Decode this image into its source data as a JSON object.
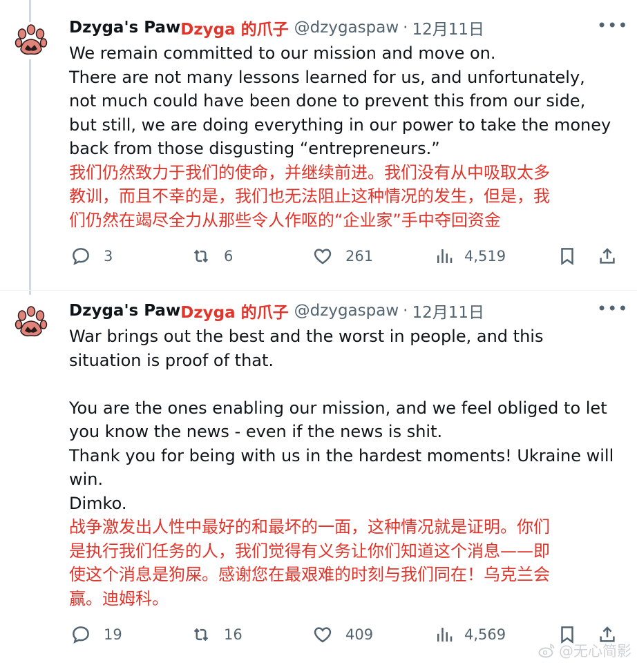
{
  "tweets": [
    {
      "author_name": "Dzyga's Paw",
      "author_name_cn": "Dzyga 的爪子",
      "handle": "@dzygaspaw",
      "separator": "·",
      "date": "12月11日",
      "more_label": "•••",
      "text_en": [
        "We remain committed to our mission and move on.",
        "There are not many lessons learned for us, and unfortunately,",
        "not much could have been done to prevent this from our side,",
        "but still, we are doing everything in our power to take the money",
        "back from those disgusting “entrepreneurs.”"
      ],
      "text_cn": [
        "我们仍然致力于我们的使命，并继续前进。我们没有从中吸取太多",
        "教训，而且不幸的是，我们也无法阻止这种情况的发生，但是，我",
        "们仍然在竭尽全力从那些令人作呕的“企业家”手中夺回资金"
      ],
      "replies": "3",
      "retweets": "6",
      "likes": "261",
      "views": "4,519"
    },
    {
      "author_name": "Dzyga's Paw",
      "author_name_cn": "Dzyga 的爪子",
      "handle": "@dzygaspaw",
      "separator": "·",
      "date": "12月11日",
      "more_label": "•••",
      "text_en": [
        "War brings out the best and the worst in people, and this",
        "situation is proof of that.",
        "",
        "You are the ones enabling our mission, and we feel obliged to let",
        "you know the news - even if the news is shit.",
        "Thank you for being with us in the hardest moments! Ukraine will",
        "win.",
        "Dimko."
      ],
      "text_cn": [
        "战争激发出人性中最好的和最坏的一面，这种情况就是证明。你们",
        "是执行我们任务的人，我们觉得有义务让你们知道这个消息——即",
        "使这个消息是狗屎。感谢您在最艰难的时刻与我们同在！乌克兰会",
        "赢。迪姆科。"
      ],
      "replies": "19",
      "retweets": "16",
      "likes": "409",
      "views": "4,569"
    }
  ],
  "watermark": "@无心简影",
  "icons": {
    "avatar": "paw-avatar-icon",
    "reply": "reply-icon",
    "retweet": "retweet-icon",
    "like": "heart-icon",
    "views": "views-icon",
    "bookmark": "bookmark-icon",
    "share": "share-icon",
    "more": "more-icon"
  },
  "colors": {
    "accent_red": "#e0352b",
    "secondary_text": "#536471",
    "primary_text": "#0f1419",
    "paw_pink": "#e0837b",
    "paw_dark": "#2b1a1a"
  }
}
